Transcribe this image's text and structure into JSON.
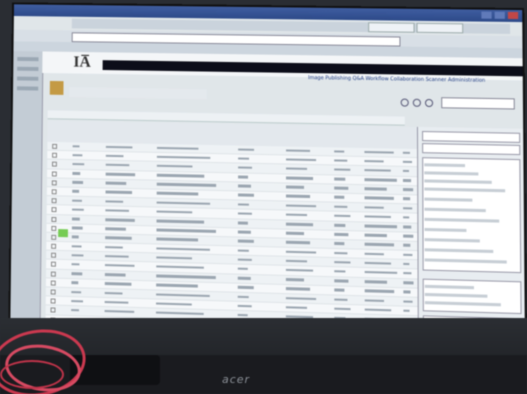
{
  "logo": {
    "text": "IA̅"
  },
  "navlinks": "Image  Publishing  Q&A  Workflow  Collaboration  Scanner  Administration",
  "monitor": {
    "brand": "acer"
  }
}
